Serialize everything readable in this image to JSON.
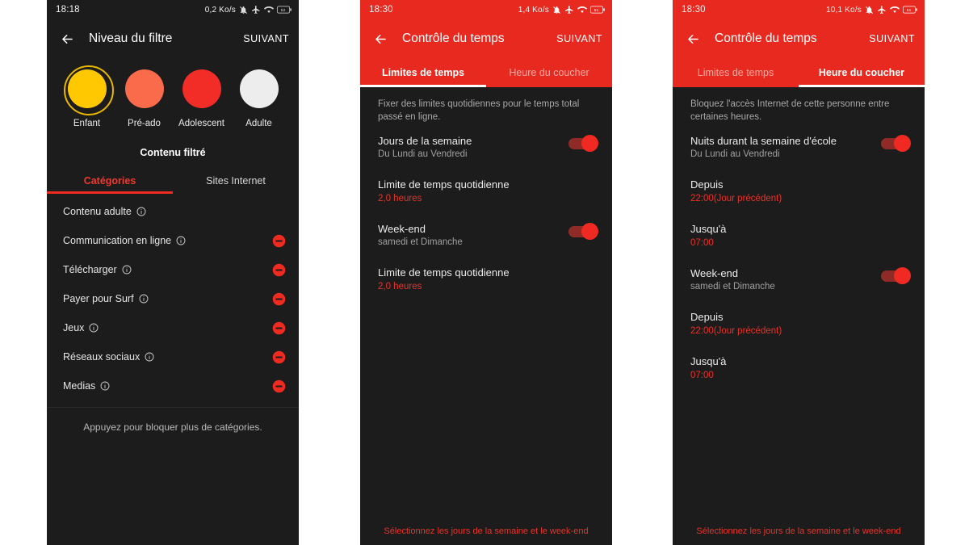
{
  "panels": [
    {
      "status": {
        "time": "18:18",
        "rate": "0,2 Ko/s",
        "icons": [
          "bell-off-icon",
          "airplane-icon",
          "wifi-icon",
          "battery-icon"
        ]
      },
      "appbar": {
        "back": "←",
        "title": "Niveau du filtre",
        "next": "SUIVANT"
      },
      "levels": [
        {
          "label": "Enfant",
          "color": "#FFC800",
          "selected": true
        },
        {
          "label": "Pré-ado",
          "color": "#FA6B4B",
          "selected": false
        },
        {
          "label": "Adolescent",
          "color": "#F22D28",
          "selected": false
        },
        {
          "label": "Adulte",
          "color": "#EDEDED",
          "selected": false
        }
      ],
      "section_title": "Contenu filtré",
      "tabs": [
        {
          "label": "Catégories",
          "active": true
        },
        {
          "label": "Sites Internet",
          "active": false
        }
      ],
      "categories": [
        {
          "name": "Contenu adulte",
          "blocked": false
        },
        {
          "name": "Communication en ligne",
          "blocked": true
        },
        {
          "name": "Télécharger",
          "blocked": true
        },
        {
          "name": "Payer pour Surf",
          "blocked": true
        },
        {
          "name": "Jeux",
          "blocked": true
        },
        {
          "name": "Réseaux sociaux",
          "blocked": true
        },
        {
          "name": "Medias",
          "blocked": true
        }
      ],
      "hint": "Appuyez pour bloquer plus de catégories."
    },
    {
      "status": {
        "time": "18:30",
        "rate": "1,4 Ko/s"
      },
      "appbar": {
        "title": "Contrôle du temps",
        "next": "SUIVANT"
      },
      "tabs": [
        {
          "label": "Limites de temps",
          "active": true
        },
        {
          "label": "Heure du coucher",
          "active": false
        }
      ],
      "intro": "Fixer des limites quotidiennes pour le temps total passé en ligne.",
      "rows": [
        {
          "kind": "toggle",
          "title": "Jours de la semaine",
          "sub": "Du Lundi au Vendredi",
          "on": true
        },
        {
          "kind": "value",
          "title": "Limite de temps quotidienne",
          "value": "2,0 heures"
        },
        {
          "kind": "toggle",
          "title": "Week-end",
          "sub": "samedi et Dimanche",
          "on": true
        },
        {
          "kind": "value",
          "title": "Limite de temps quotidienne",
          "value": "2,0 heures"
        }
      ],
      "footer": "Sélectionnez les jours de la semaine et le week-end"
    },
    {
      "status": {
        "time": "18:30",
        "rate": "10,1 Ko/s"
      },
      "appbar": {
        "title": "Contrôle du temps",
        "next": "SUIVANT"
      },
      "tabs": [
        {
          "label": "Limites de temps",
          "active": false
        },
        {
          "label": "Heure du coucher",
          "active": true
        }
      ],
      "intro": "Bloquez l'accès Internet de cette personne entre certaines heures.",
      "rows": [
        {
          "kind": "toggle",
          "title": "Nuits durant la semaine d'école",
          "sub": "Du Lundi au Vendredi",
          "on": true
        },
        {
          "kind": "value",
          "title": "Depuis",
          "value": "22:00(Jour précédent)"
        },
        {
          "kind": "value",
          "title": "Jusqu'à",
          "value": "07:00"
        },
        {
          "kind": "toggle",
          "title": "Week-end",
          "sub": "samedi et Dimanche",
          "on": true
        },
        {
          "kind": "value",
          "title": "Depuis",
          "value": "22:00(Jour précédent)"
        },
        {
          "kind": "value",
          "title": "Jusqu'à",
          "value": "07:00"
        }
      ],
      "footer": "Sélectionnez les jours de la semaine et le week-end"
    }
  ],
  "colors": {
    "accent_red": "#e8291f",
    "value_red": "#e8332a",
    "panel_bg": "#1c1c1c",
    "page_bg": "#ffffff"
  }
}
